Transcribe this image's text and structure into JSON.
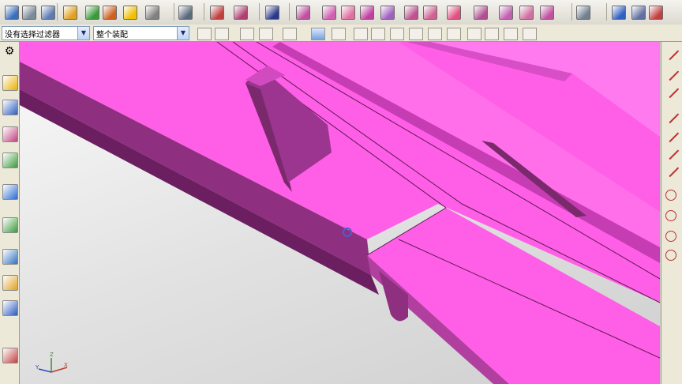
{
  "filter": {
    "type_filter": "没有选择过滤器",
    "scope_filter": "整个装配"
  },
  "colors": {
    "model_top": "#ff5ee6",
    "model_side": "#8f2f80",
    "model_shadow": "#6b1f61",
    "model_light": "#ff8cf0",
    "viewport_bg": "#e6e6e6",
    "toolbar_bg": "#ece9d8"
  },
  "toolbar_icons": [
    "select-all-icon",
    "layers-icon",
    "layer-settings-icon",
    "fit-icon",
    "zoom-icon",
    "pan-icon",
    "rotate-icon",
    "view-orientation-icon",
    "snap-icon",
    "render-style-icon",
    "shaded-icon",
    "blue-disc-icon",
    "box-view-1-icon",
    "box-view-2-icon",
    "box-view-3-icon",
    "box-view-4-icon",
    "box-view-5-icon",
    "box-view-6-icon",
    "box-view-7-icon",
    "box-view-8-icon",
    "box-view-9-icon",
    "box-view-10-icon",
    "box-view-11-icon",
    "box-view-12-icon",
    "tools-icon",
    "window-icon",
    "refresh-icon",
    "settings-icon"
  ],
  "left_toolbar_icons": [
    "gear-icon",
    "assembly-navigator-icon",
    "constraint-navigator-icon",
    "part-navigator-icon",
    "reuse-library-icon",
    "web-browser-icon",
    "history-icon",
    "system-materials-icon",
    "process-studio-icon",
    "visualization-icon",
    "roles-icon"
  ],
  "right_toolbar_icons": [
    "line-icon",
    "line-at-angle-icon",
    "parallel-line-icon",
    "arc-icon",
    "arc-tangent-icon",
    "fillet-icon",
    "corner-icon",
    "circle-icon",
    "circle-center-icon",
    "circle-tangent-icon",
    "circle-point-icon"
  ]
}
